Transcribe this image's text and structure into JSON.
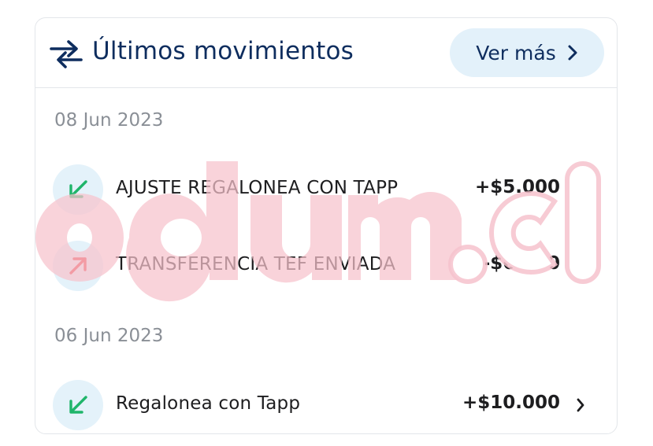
{
  "header": {
    "title": "Últimos movimientos",
    "more_label": "Ver más",
    "icon": "transfer-arrows-icon"
  },
  "groups": [
    {
      "date": "08 Jun 2023",
      "items": [
        {
          "label": "AJUSTE REGALONEA CON TAPP",
          "amount": "+$5.000",
          "direction": "in"
        },
        {
          "label": "TRANSFERENCIA TEF ENVIADA",
          "amount": "-$6.300",
          "direction": "out"
        }
      ]
    },
    {
      "date": "06 Jun 2023",
      "items": [
        {
          "label": "Regalonea con Tapp",
          "amount": "+$10.000",
          "direction": "in"
        }
      ]
    }
  ],
  "watermark": {
    "text": "odum.cl"
  },
  "colors": {
    "primary": "#0e2d5e",
    "incoming": "#1fb56a",
    "outgoing": "#e8383f",
    "pill_bg": "#e3f1fa",
    "watermark": "#f6c2cc"
  }
}
